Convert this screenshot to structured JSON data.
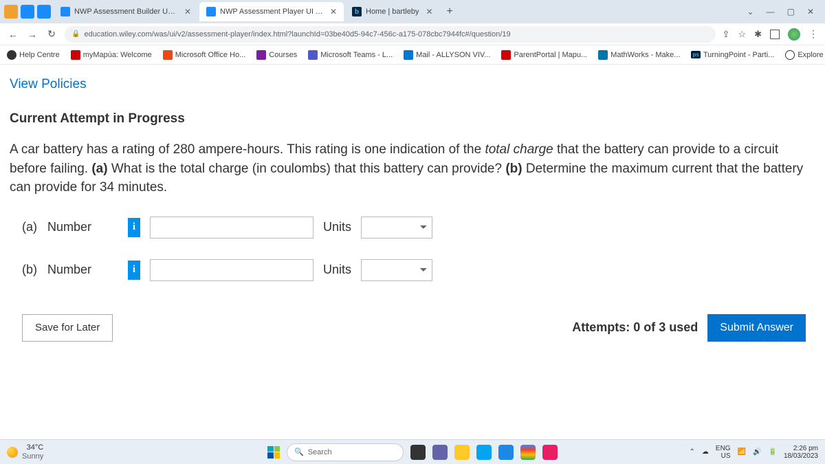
{
  "tabs": [
    {
      "title": "NWP Assessment Builder UI App"
    },
    {
      "title": "NWP Assessment Player UI Appli"
    },
    {
      "title": "Home | bartleby"
    }
  ],
  "url": "education.wiley.com/was/ui/v2/assessment-player/index.html?launchId=03be40d5-94c7-456c-a175-078cbc7944fc#/question/19",
  "bookmarks": {
    "help": "Help Centre",
    "mapua": "myMapúa: Welcome",
    "ms": "Microsoft Office Ho...",
    "courses": "Courses",
    "teams": "Microsoft Teams - L...",
    "mail": "Mail - ALLYSON VIV...",
    "parent": "ParentPortal | Mapu...",
    "mw": "MathWorks - Make...",
    "tp": "TurningPoint - Parti...",
    "gh": "Explore GitHub"
  },
  "page": {
    "policies": "View Policies",
    "heading": "Current Attempt in Progress",
    "q_pre": "A car battery has a rating of 280 ampere-hours. This rating is one indication of the ",
    "q_em": "total charge",
    "q_post": " that the battery can provide to a circuit before failing. ",
    "q_a": "(a)",
    "q_a_txt": " What is the total charge (in coulombs) that this battery can provide? ",
    "q_b": "(b)",
    "q_b_txt": " Determine the maximum current that the battery can provide for 34 minutes.",
    "rowA": {
      "part": "(a)",
      "num": "Number",
      "units": "Units"
    },
    "rowB": {
      "part": "(b)",
      "num": "Number",
      "units": "Units"
    },
    "save": "Save for Later",
    "attempts": "Attempts: 0 of 3 used",
    "submit": "Submit Answer"
  },
  "taskbar": {
    "temp": "34°C",
    "cond": "Sunny",
    "search": "Search",
    "lang1": "ENG",
    "lang2": "US",
    "time": "2:26 pm",
    "date": "18/03/2023"
  }
}
